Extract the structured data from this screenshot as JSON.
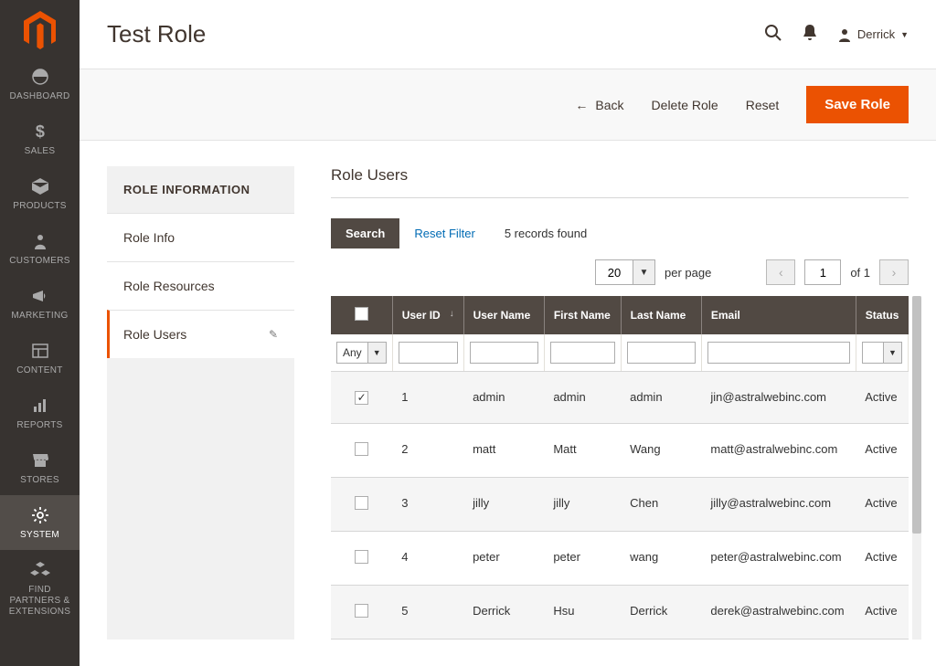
{
  "sidebar": {
    "items": [
      {
        "label": "DASHBOARD",
        "icon": "dashboard"
      },
      {
        "label": "SALES",
        "icon": "dollar"
      },
      {
        "label": "PRODUCTS",
        "icon": "box"
      },
      {
        "label": "CUSTOMERS",
        "icon": "person"
      },
      {
        "label": "MARKETING",
        "icon": "megaphone"
      },
      {
        "label": "CONTENT",
        "icon": "layout"
      },
      {
        "label": "REPORTS",
        "icon": "bars"
      },
      {
        "label": "STORES",
        "icon": "storefront"
      },
      {
        "label": "SYSTEM",
        "icon": "gear",
        "active": true
      },
      {
        "label": "FIND PARTNERS & EXTENSIONS",
        "icon": "cubes"
      }
    ]
  },
  "header": {
    "title": "Test Role",
    "user_name": "Derrick"
  },
  "actions": {
    "back": "Back",
    "delete": "Delete Role",
    "reset": "Reset",
    "save": "Save Role"
  },
  "side_tabs": {
    "title": "ROLE INFORMATION",
    "items": [
      {
        "label": "Role Info"
      },
      {
        "label": "Role Resources"
      },
      {
        "label": "Role Users",
        "active": true,
        "editable": true
      }
    ]
  },
  "panel": {
    "title": "Role Users"
  },
  "grid": {
    "search_label": "Search",
    "reset_filter_label": "Reset Filter",
    "records_label": "5 records found",
    "per_page_value": "20",
    "per_page_label": "per page",
    "current_page": "1",
    "total_pages_label": "of 1",
    "any_label": "Any",
    "columns": [
      {
        "key": "checkbox"
      },
      {
        "key": "user_id",
        "label": "User ID",
        "sort": "asc"
      },
      {
        "key": "user_name",
        "label": "User Name"
      },
      {
        "key": "first_name",
        "label": "First Name"
      },
      {
        "key": "last_name",
        "label": "Last Name"
      },
      {
        "key": "email",
        "label": "Email"
      },
      {
        "key": "status",
        "label": "Status"
      }
    ],
    "rows": [
      {
        "checked": true,
        "user_id": "1",
        "user_name": "admin",
        "first_name": "admin",
        "last_name": "admin",
        "email": "jin@astralwebinc.com",
        "status": "Active"
      },
      {
        "checked": false,
        "user_id": "2",
        "user_name": "matt",
        "first_name": "Matt",
        "last_name": "Wang",
        "email": "matt@astralwebinc.com",
        "status": "Active"
      },
      {
        "checked": false,
        "user_id": "3",
        "user_name": "jilly",
        "first_name": "jilly",
        "last_name": "Chen",
        "email": "jilly@astralwebinc.com",
        "status": "Active"
      },
      {
        "checked": false,
        "user_id": "4",
        "user_name": "peter",
        "first_name": "peter",
        "last_name": "wang",
        "email": "peter@astralwebinc.com",
        "status": "Active"
      },
      {
        "checked": false,
        "user_id": "5",
        "user_name": "Derrick",
        "first_name": "Hsu",
        "last_name": "Derrick",
        "email": "derek@astralwebinc.com",
        "status": "Active"
      }
    ]
  }
}
